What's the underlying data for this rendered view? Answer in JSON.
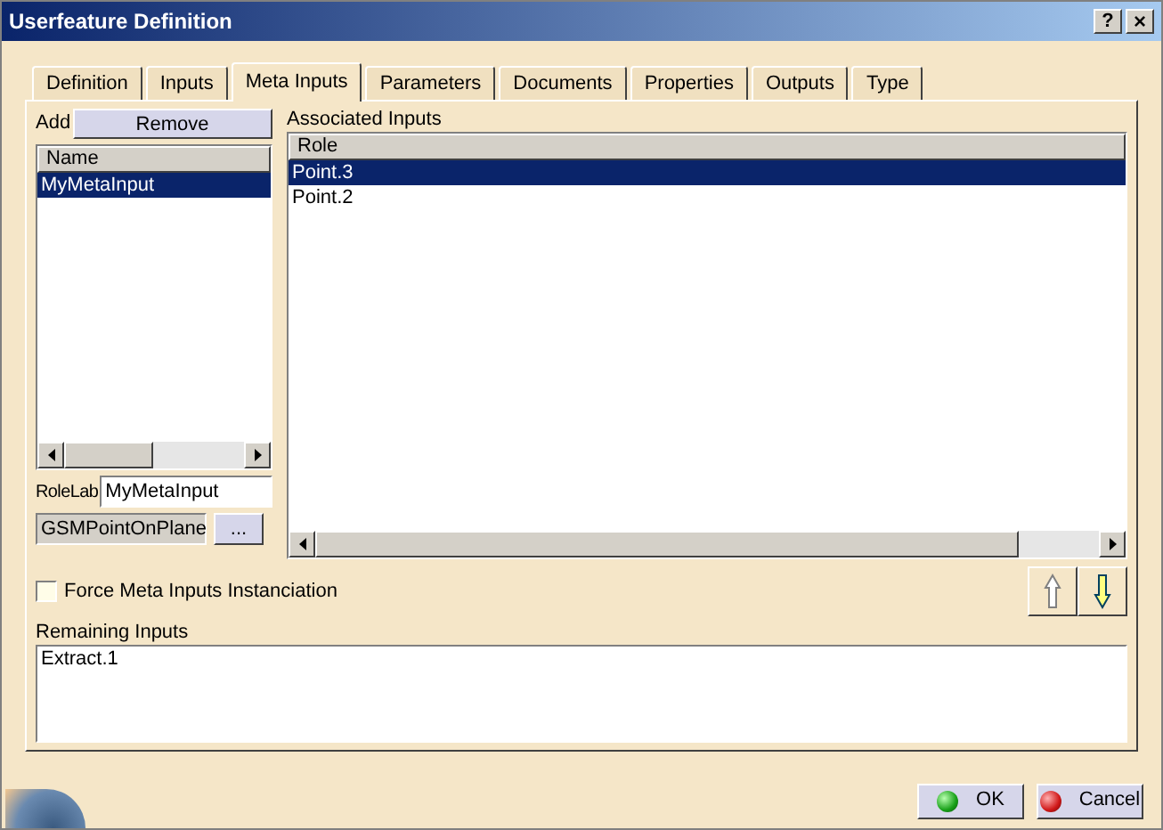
{
  "window": {
    "title": "Userfeature Definition",
    "help": "?",
    "close": "×"
  },
  "tabs": [
    {
      "label": "Definition",
      "selected": false
    },
    {
      "label": "Inputs",
      "selected": false
    },
    {
      "label": "Meta Inputs",
      "selected": true
    },
    {
      "label": "Parameters",
      "selected": false
    },
    {
      "label": "Documents",
      "selected": false
    },
    {
      "label": "Properties",
      "selected": false
    },
    {
      "label": "Outputs",
      "selected": false
    },
    {
      "label": "Type",
      "selected": false
    }
  ],
  "meta_inputs": {
    "add_label": "Add",
    "remove_button": "Remove",
    "column": "Name",
    "items": [
      {
        "label": "MyMetaInput",
        "selected": true
      }
    ],
    "role_label": "RoleLab",
    "role_value": "MyMetaInput",
    "type_value": "GSMPointOnPlane",
    "browse_button": "..."
  },
  "associated_inputs": {
    "label": "Associated Inputs",
    "column": "Role",
    "rows": [
      {
        "label": "Point.3",
        "selected": true
      },
      {
        "label": "Point.2",
        "selected": false
      }
    ]
  },
  "force_checkbox": {
    "label": "Force Meta Inputs Instanciation",
    "checked": false
  },
  "remaining_inputs": {
    "label": "Remaining Inputs",
    "items": [
      "Extract.1"
    ]
  },
  "buttons": [
    {
      "label": "OK",
      "kind": "ok"
    },
    {
      "label": "Cancel",
      "kind": "cancel"
    }
  ]
}
